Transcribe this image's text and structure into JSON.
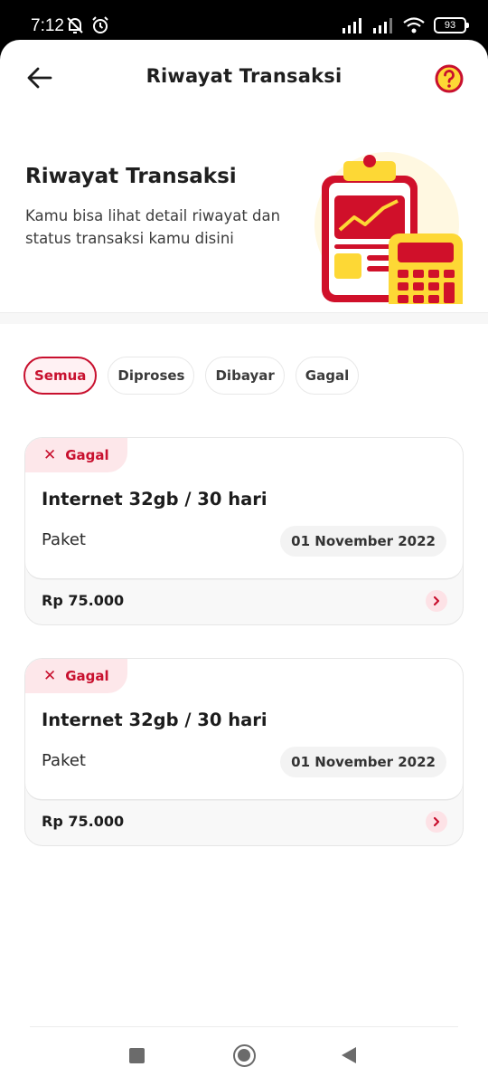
{
  "status_bar": {
    "time": "7:12",
    "battery": "93"
  },
  "app_bar": {
    "title": "Riwayat Transaksi"
  },
  "hero": {
    "title": "Riwayat Transaksi",
    "description": "Kamu bisa lihat detail riwayat dan status transaksi kamu disini"
  },
  "filters": [
    {
      "label": "Semua",
      "active": true
    },
    {
      "label": "Diproses",
      "active": false
    },
    {
      "label": "Dibayar",
      "active": false
    },
    {
      "label": "Gagal",
      "active": false
    }
  ],
  "transactions": [
    {
      "status": "Gagal",
      "title": "Internet 32gb / 30 hari",
      "type": "Paket",
      "date": "01 November 2022",
      "price": "Rp 75.000"
    },
    {
      "status": "Gagal",
      "title": "Internet 32gb / 30 hari",
      "type": "Paket",
      "date": "01 November 2022",
      "price": "Rp 75.000"
    }
  ],
  "icons": {
    "back": "arrow-left-icon",
    "help": "question-circle-icon",
    "status_fail": "x-icon",
    "row_chevron": "chevron-right-icon"
  },
  "colors": {
    "primary": "#c8102e",
    "primary_light": "#fde7ea",
    "accent_yellow": "#fdd835"
  }
}
